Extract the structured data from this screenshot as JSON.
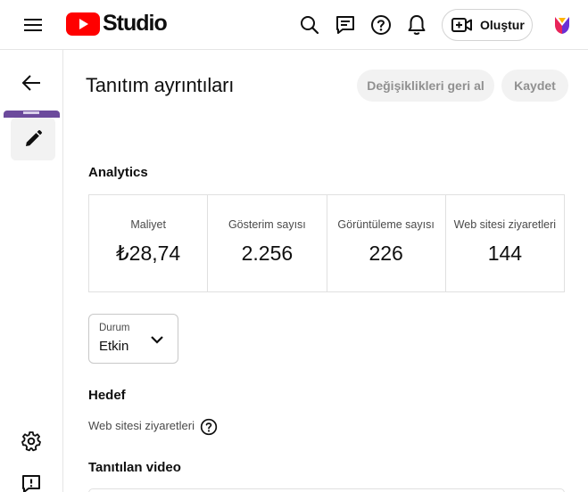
{
  "app": {
    "logo_text": "Studio",
    "create_label": "Oluştur"
  },
  "icons": {
    "menu": "hamburger-menu-icon",
    "search": "search-icon",
    "feedback_chat": "message-icon",
    "help": "help-icon",
    "notifications": "bell-icon",
    "create": "video-plus-icon",
    "back": "arrow-left-icon",
    "edit": "pencil-icon",
    "settings": "gear-icon",
    "report": "feedback-icon"
  },
  "header": {
    "title": "Tanıtım ayrıntıları",
    "undo_label": "Değişiklikleri geri al",
    "save_label": "Kaydet"
  },
  "analytics": {
    "title": "Analytics",
    "stats": [
      {
        "label": "Maliyet",
        "value": "₺28,74"
      },
      {
        "label": "Gösterim sayısı",
        "value": "2.256"
      },
      {
        "label": "Görüntüleme sayısı",
        "value": "226"
      },
      {
        "label": "Web sitesi ziyaretleri",
        "value": "144"
      }
    ]
  },
  "status": {
    "label": "Durum",
    "value": "Etkin"
  },
  "goal": {
    "title": "Hedef",
    "value": "Web sitesi ziyaretleri"
  },
  "promoted_video": {
    "title": "Tanıtılan video"
  },
  "colors": {
    "brand_red": "#ff0000",
    "disabled_button_bg": "#f2f2f2",
    "disabled_button_text": "#909090",
    "thumbnail_purple": "#6c4a9c"
  }
}
